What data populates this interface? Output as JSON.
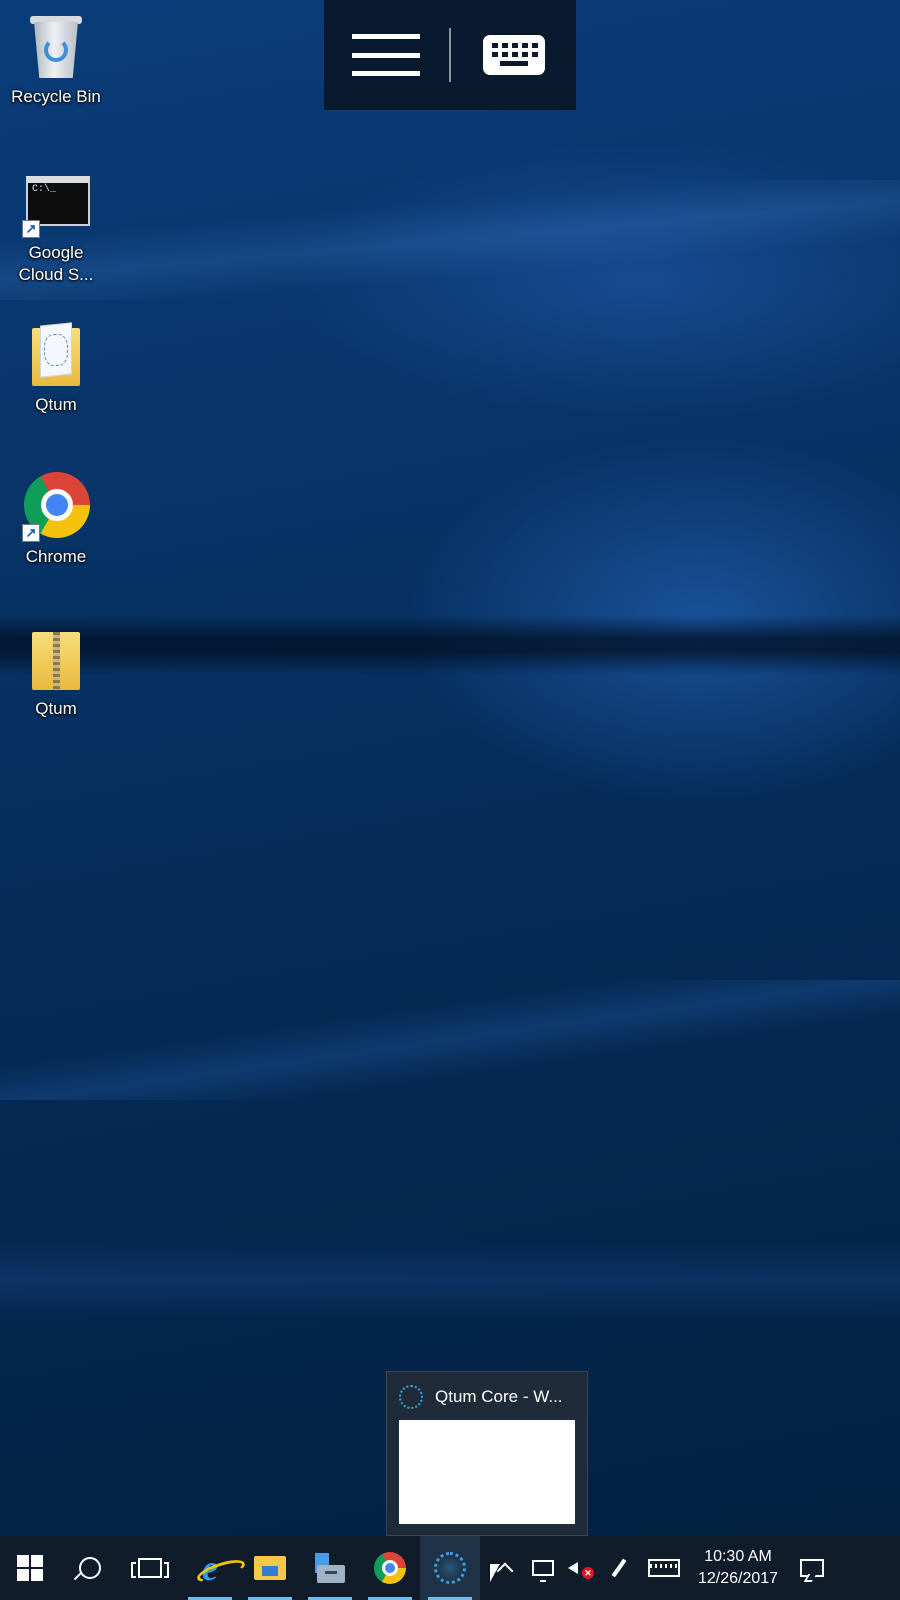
{
  "remote_toolbar": {
    "menu_icon": "hamburger-menu-icon",
    "keyboard_icon": "keyboard-icon"
  },
  "desktop": {
    "icons": [
      {
        "label": "Recycle Bin",
        "icon": "recycle-bin-icon"
      },
      {
        "label": "Google Cloud S...",
        "icon": "command-prompt-icon"
      },
      {
        "label": "Qtum",
        "icon": "folder-icon"
      },
      {
        "label": "Chrome",
        "icon": "chrome-icon"
      },
      {
        "label": "Qtum",
        "icon": "zip-folder-icon"
      }
    ]
  },
  "thumbnail_preview": {
    "title": "Qtum Core - W...",
    "icon": "qtum-icon"
  },
  "taskbar": {
    "items": [
      {
        "name": "start",
        "icon": "windows-icon"
      },
      {
        "name": "search",
        "icon": "search-icon"
      },
      {
        "name": "task-view",
        "icon": "task-view-icon"
      },
      {
        "name": "internet-explorer",
        "icon": "internet-explorer-icon"
      },
      {
        "name": "file-explorer",
        "icon": "file-explorer-icon"
      },
      {
        "name": "server-manager",
        "icon": "server-manager-icon"
      },
      {
        "name": "chrome",
        "icon": "chrome-icon"
      },
      {
        "name": "qtum-core",
        "icon": "qtum-icon"
      }
    ],
    "tray": {
      "icons": [
        "chevron-up-icon",
        "network-icon",
        "volume-muted-icon",
        "pen-icon",
        "touch-keyboard-icon"
      ],
      "time": "10:30 AM",
      "date": "12/26/2017",
      "notification_icon": "action-center-icon"
    }
  },
  "colors": {
    "taskbar_bg": "#101c2a",
    "accent": "#76b9ed",
    "qtum": "#39a0e8"
  }
}
